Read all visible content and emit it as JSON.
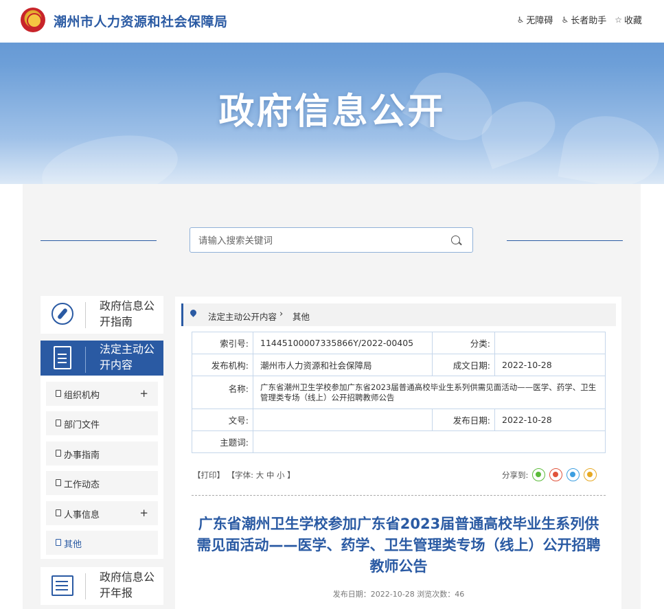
{
  "header": {
    "site_title": "潮州市人力资源和社会保障局",
    "tools": [
      {
        "label": "无障碍",
        "icon": "accessibility-icon"
      },
      {
        "label": "长者助手",
        "icon": "elder-icon"
      },
      {
        "label": "收藏",
        "icon": "star-icon"
      }
    ],
    "hero_title": "政府信息公开"
  },
  "search": {
    "placeholder": "请输入搜索关键词"
  },
  "sidebar": {
    "cards": [
      {
        "label": "政府信息公开指南",
        "icon": "compass-icon"
      },
      {
        "label": "法定主动公开内容",
        "icon": "document-icon",
        "active": true
      },
      {
        "label": "政府信息公开年报",
        "icon": "report-icon"
      }
    ],
    "items": [
      {
        "label": "组织机构",
        "expandable": true
      },
      {
        "label": "部门文件",
        "expandable": false
      },
      {
        "label": "办事指南",
        "expandable": false
      },
      {
        "label": "工作动态",
        "expandable": false
      },
      {
        "label": "人事信息",
        "expandable": true
      },
      {
        "label": "其他",
        "expandable": false,
        "current": true
      }
    ],
    "expand_symbol": "+"
  },
  "breadcrumb": {
    "parent": "法定主动公开内容",
    "separator": "›",
    "current": "其他"
  },
  "meta": {
    "index_label": "索引号:",
    "index_value": "11445100007335866Y/2022-00405",
    "category_label": "分类:",
    "category_value": "",
    "publisher_label": "发布机构:",
    "publisher_value": "潮州市人力资源和社会保障局",
    "created_label": "成文日期:",
    "created_value": "2022-10-28",
    "name_label": "名称:",
    "name_value": "广东省潮州卫生学校参加广东省2023届普通高校毕业生系列供需见面活动——医学、药学、卫生管理类专场（线上）公开招聘教师公告",
    "docno_label": "文号:",
    "docno_value": "",
    "published_label": "发布日期:",
    "published_value": "2022-10-28",
    "subject_label": "主题词:",
    "subject_value": ""
  },
  "options": {
    "print": "【打印】",
    "font_prefix": "【字体:",
    "font_large": "大",
    "font_medium": "中",
    "font_small": "小",
    "font_suffix": "】",
    "share_label": "分享到:"
  },
  "article": {
    "title": "广东省潮州卫生学校参加广东省2023届普通高校毕业生系列供需见面活动——医学、药学、卫生管理类专场（线上）公开招聘教师公告",
    "meta_line": "发布日期：2022-10-28  浏览次数：46"
  },
  "colors": {
    "brand": "#2a5aa3",
    "panel_bg": "#f4f4f4"
  }
}
